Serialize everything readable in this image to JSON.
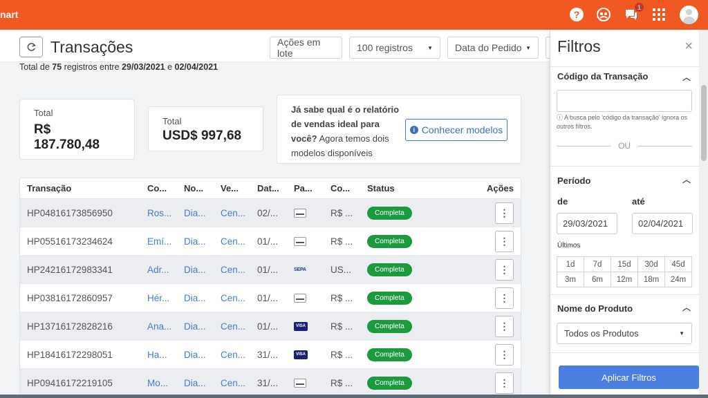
{
  "topbar": {
    "brand": "nart",
    "help_icon": "?",
    "notification_count": "1"
  },
  "header": {
    "title": "Transações",
    "batch_button": "Ações em lote",
    "page_size": "100 registros",
    "sort_field": "Data do Pedido"
  },
  "summary": {
    "prefix": "Total de",
    "count": "75",
    "mid": "registros entre",
    "date_from": "29/03/2021",
    "conj": "e",
    "date_to": "02/04/2021"
  },
  "cards": {
    "brl_label": "Total",
    "brl_value": "R$ 187.780,48",
    "usd_label": "Total",
    "usd_value": "USD$ 997,68"
  },
  "promo": {
    "bold_line": "Já sabe qual é o relatório de vendas ideal para você?",
    "rest": "Agora temos dois modelos disponíveis",
    "button": "Conhecer modelos"
  },
  "table": {
    "headers": [
      "Transação",
      "Co...",
      "No...",
      "Ve...",
      "Dat...",
      "Pa...",
      "Co...",
      "Status",
      "Ações"
    ],
    "rows": [
      {
        "id": "HP04816173856950",
        "comprador": "Ros...",
        "nome": "Dia...",
        "vendedor": "Cen...",
        "data": "02/...",
        "pagamento": "boleto",
        "comissao": "R$ ...",
        "status": "Completa"
      },
      {
        "id": "HP05516173234624",
        "comprador": "Emí...",
        "nome": "Dia...",
        "vendedor": "Cen...",
        "data": "01/...",
        "pagamento": "boleto",
        "comissao": "R$ ...",
        "status": "Completa"
      },
      {
        "id": "HP24216172983341",
        "comprador": "Adr...",
        "nome": "Dia...",
        "vendedor": "Cen...",
        "data": "01/...",
        "pagamento": "sepa",
        "comissao": "US...",
        "status": "Completa"
      },
      {
        "id": "HP03816172860957",
        "comprador": "Hér...",
        "nome": "Dia...",
        "vendedor": "Cen...",
        "data": "01/...",
        "pagamento": "boleto",
        "comissao": "R$ ...",
        "status": "Completa"
      },
      {
        "id": "HP13716172828216",
        "comprador": "Ana...",
        "nome": "Dia...",
        "vendedor": "Cen...",
        "data": "01/...",
        "pagamento": "visa",
        "comissao": "R$ ...",
        "status": "Completa"
      },
      {
        "id": "HP18416172298051",
        "comprador": "Ha...",
        "nome": "Dia...",
        "vendedor": "Cen...",
        "data": "31/...",
        "pagamento": "visa",
        "comissao": "R$ ...",
        "status": "Completa"
      },
      {
        "id": "HP09416172219105",
        "comprador": "Mo...",
        "nome": "Dia...",
        "vendedor": "Cen...",
        "data": "31/...",
        "pagamento": "boleto",
        "comissao": "R$ ...",
        "status": "Completa"
      }
    ],
    "sepa_label": "SEPA",
    "visa_label": "VISA"
  },
  "filters": {
    "title": "Filtros",
    "close": "×",
    "code_section": "Código da Transação",
    "code_value": "",
    "code_hint": "A busca pelo 'código da transação' ignora os outros filtros.",
    "ou": "OU",
    "period_section": "Período",
    "from_label": "de",
    "to_label": "até",
    "from_date": "29/03/2021",
    "to_date": "02/04/2021",
    "last_label": "Últimos",
    "quick_ranges": [
      "1d",
      "7d",
      "15d",
      "30d",
      "45d",
      "3m",
      "6m",
      "12m",
      "18m",
      "24m"
    ],
    "product_section": "Nome do Produto",
    "product_value": "Todos os Produtos",
    "apply": "Aplicar Filtros"
  },
  "colors": {
    "brand": "#f05a22",
    "link": "#4a7bd0",
    "status_green": "#1c9a3e",
    "apply_blue": "#4a7ee0"
  }
}
